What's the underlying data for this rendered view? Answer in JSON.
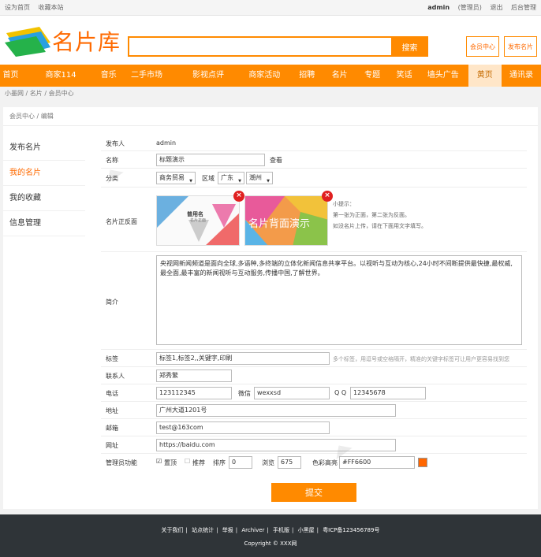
{
  "topbar": {
    "set_home": "设为首页",
    "bookmark": "收藏本站",
    "user": "admin",
    "role": "(管理员)",
    "logout": "退出",
    "admin_panel": "后台管理"
  },
  "header": {
    "logo_text": "名片库",
    "search_placeholder": "",
    "search_button": "搜索",
    "member_center": "会员中心",
    "publish_card": "发布名片"
  },
  "nav": {
    "items": [
      "首页",
      "商家114",
      "音乐",
      "二手市场",
      "影视点评",
      "商家活动",
      "招聘",
      "名片",
      "专题",
      "笑话",
      "墙头广告",
      "黄页",
      "通讯录"
    ],
    "active_index": 11
  },
  "breadcrumb": [
    "小墨网",
    "名片",
    "会员中心"
  ],
  "panel": {
    "breadcrumb": [
      "会员中心",
      "编辑"
    ],
    "sidebar": [
      "发布名片",
      "我的名片",
      "我的收藏",
      "信息管理"
    ],
    "sidebar_active": 1
  },
  "form": {
    "publisher_label": "发布人",
    "publisher_value": "admin",
    "name_label": "名称",
    "name_value": "标题演示",
    "view_link": "查看",
    "category_label": "分类",
    "category_value": "商务贸易",
    "region_label": "区域",
    "province_value": "广东",
    "city_value": "潮州",
    "card_label": "名片正反面",
    "front_card_title": "普用名",
    "front_card_sub": "名片正面",
    "back_card_title": "名片背面演示",
    "tip_title": "小提示：",
    "tip_line1": "第一张为正面，第二张为反面。",
    "tip_line2": "如没名片上传，请在下面用文字填写。",
    "intro_label": "简介",
    "intro_value": "央视网新闻频道是面向全球,多语种,多终端的立体化新闻信息共享平台。以视听与互动为核心,24小时不间断提供最快捷,最权威,最全面,最丰富的新闻视听与互动服务,传播中国,了解世界。",
    "tags_label": "标签",
    "tags_value": "标签1,标签2,,关键字,印刷",
    "tags_hint": "多个标签，用逗号或空格隔开，精准的关键字标签可让用户更容易找到您",
    "contact_label": "联系人",
    "contact_value": "郑秀繁",
    "phone_label": "电话",
    "phone_value": "123112345",
    "wechat_label": "微信",
    "wechat_value": "wexxsd",
    "qq_label": "Q Q",
    "qq_value": "12345678",
    "address_label": "地址",
    "address_value": "广州大道1201号",
    "email_label": "邮箱",
    "email_value": "test@163com",
    "website_label": "网址",
    "website_value": "https://baidu.com",
    "admin_label": "管理员功能",
    "sticky_label": "置顶",
    "sticky_checked": true,
    "recommend_label": "推荐",
    "recommend_checked": false,
    "sort_label": "排序",
    "sort_value": "0",
    "views_label": "浏览",
    "views_value": "675",
    "color_label": "色彩高亮",
    "color_value": "#FF6600",
    "submit": "提交"
  },
  "footer": {
    "links": [
      "关于我们",
      "站点统计",
      "举报",
      "Archiver",
      "手机版",
      "小黑屋",
      "粤ICP备123456789号"
    ],
    "copyright": "Copyright © XXX网"
  },
  "colors": {
    "accent": "#ff8a00",
    "logo": "#ff6a00",
    "footer_bg": "#2f3438",
    "delete": "#e02020"
  }
}
